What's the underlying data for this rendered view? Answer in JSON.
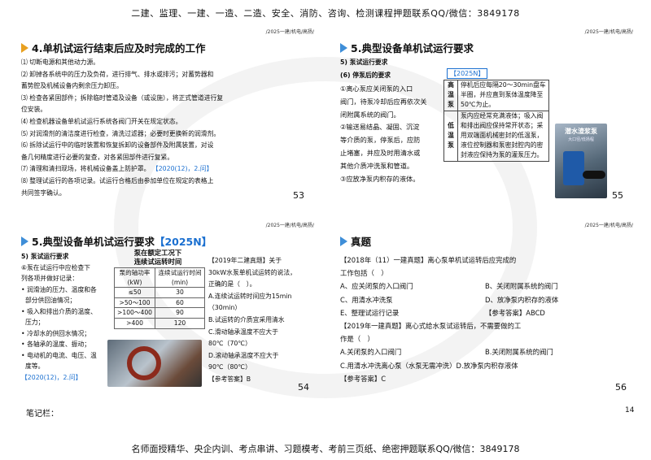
{
  "header": "二建、监理、一建、一造、二造、安全、消防、咨询、检测课程押题联系QQ/微信：3849178",
  "footer": "名师面授精华、央企内训、考点串讲、习题模考、考前三页纸、绝密押题联系QQ/微信：3849178",
  "notes_label": "笔记栏：",
  "page_number": "14",
  "panel_tag": "/2025一建/机电/高扬/",
  "p1": {
    "title": "4.单机试运行结束后应及时完成的工作",
    "items": [
      "⑴ 切断电源和其他动力源。",
      "⑵ 卸掉各系统中的压力及负荷，进行排气、排水或排污；对蓄势器和",
      "蓄势腔及机械设备内剩余压力卸压。",
      "⑶ 检查各紧固部件；拆除临时管道及设备（或设施），将正式管道进行复",
      "位安装。",
      "⑷ 检查机器设备单机试运行系统各阀门开关在规定状态。",
      "⑸ 对润滑剂的清洁度进行检查，清洗过滤器；必要时更换新的润滑剂。",
      "⑹ 拆除试运行中的临时装置和恢复拆卸的设备部件及附属装置，对设",
      "备几何精度进行必要的复查，对各紧固部件进行复紧。",
      "⑺ 清理和清扫现场，将机械设备盖上防护罩。",
      "⑻ 整理试运行的各项记录。试运行合格后由参加单位在规定的表格上",
      "共同签字确认。"
    ],
    "year_tag": "【2020(12)，2.问】",
    "page": "53"
  },
  "p2": {
    "title": "5.典型设备单机试运行要求",
    "sub1": "5) 泵试运行要求",
    "sub2": "(6) 停泵后的要求",
    "year_tag": "【2025N】",
    "items": [
      "①离心泵应关闭泵的入口",
      "阀门，待泵冷却后应再依次关",
      "闭附属系统的阀门。",
      "②输送易结晶、凝固、沉淀",
      "等介质的泵，停泵后，应防",
      "止堵塞，并应及时用清水或",
      "其他介质冲洗泵和管道。",
      "③应放净泵内积存的液体。"
    ],
    "table": [
      {
        "label": "高温泵",
        "text": "停机后应每隔20～30min盘车半圈，并应直到泵体温度降至50℃为止。"
      },
      {
        "label": "低温泵",
        "text": "泵内应经常充满液体；吸入阀和排出阀应保持常开状态；采用双端面机械密封的低温泵，液位控制器和泵密封腔内的密封液应保持为泵的灌泵压力。"
      }
    ],
    "img_title": "潜水渣浆泵",
    "img_sub": "大口径/低扬程",
    "page": "55"
  },
  "p3": {
    "title": "5.典型设备单机试运行要求",
    "year_tag": "【2025N】",
    "sub1": "5) 泵试运行要求",
    "sub2": "⑥泵在试运行中应检查下",
    "sub3": "列各项并做好记录：",
    "bullets": [
      "润滑油的压力、温度和各",
      "部分供回油情况；",
      "吸入和排出介质的温度、",
      "压力；",
      "冷却水的供回水情况；",
      "各轴承的温度、振动；",
      "电动机的电流、电压、温",
      "度等。"
    ],
    "year_tag2": "【2020(12)，2.问】",
    "table_title1": "泵在额定工况下",
    "table_title2": "连续试运转时间",
    "table_head": [
      "泵的轴功率(kW)",
      "连续试运行时间(min)"
    ],
    "table_rows": [
      [
        "≤50",
        "30"
      ],
      [
        ">50～100",
        "60"
      ],
      [
        ">100～400",
        "90"
      ],
      [
        ">400",
        "120"
      ]
    ],
    "q_lines": [
      "【2019年二建真题】关于",
      "30kW水泵单机试运转的说法，",
      "正确的是（　）。",
      "A.连续试运转时间应为15min",
      "（30min）",
      "B.试运转的介质宜采用清水",
      "C.滑动轴承温度不应大于",
      "80℃（70℃）",
      "D.滚动轴承温度不应大于",
      "90℃（80℃）",
      "【参考答案】B"
    ],
    "page": "54"
  },
  "p4": {
    "title": "真题",
    "lines": [
      "【2018年（11）一建真题】离心泵单机试运转后应完成的",
      "工作包括（　）"
    ],
    "opts1": [
      [
        "A、应关闭泵的入口阀门",
        "B、关闭附属系统的阀门"
      ],
      [
        "C、用清水冲洗泵",
        "D、放净泵内积存的液体"
      ],
      [
        "E、整理试运行记录",
        "【参考答案】ABCD"
      ]
    ],
    "q2": [
      "【2019年一建真题】离心式给水泵试运转后，不需要做的工",
      "作是（　）"
    ],
    "opts2": [
      [
        "A.关闭泵的入口阀门",
        "B.关闭附属系统的阀门"
      ]
    ],
    "opt_c": "C.用清水冲洗离心泵（水泵无需冲洗）D.放净泵内积存液体",
    "answer": "【参考答案】C",
    "page": "56"
  }
}
